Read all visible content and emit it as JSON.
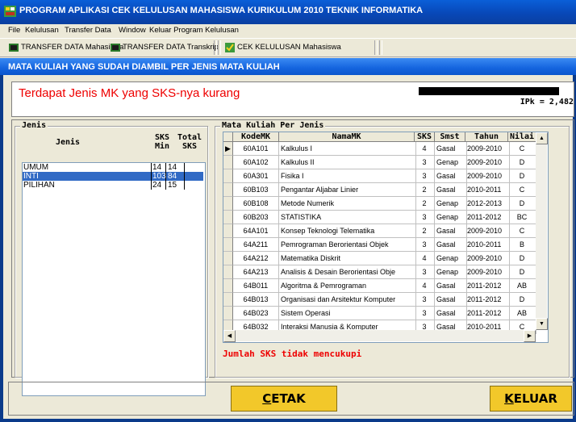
{
  "app": {
    "title": "PROGRAM APLIKASI CEK KELULUSAN MAHASISWA KURIKULUM 2010 TEKNIK INFORMATIKA"
  },
  "menu": [
    "File",
    "Kelulusan",
    "Transfer Data",
    "Window",
    "Keluar Program Kelulusan"
  ],
  "toolbar": {
    "items": [
      {
        "label": "TRANSFER DATA Mahasiswa",
        "icon": "transfer-icon"
      },
      {
        "label": "TRANSFER DATA Transkrip",
        "icon": "transfer-icon"
      },
      {
        "label": "CEK KELULUSAN Mahasiswa",
        "icon": "check-icon"
      }
    ]
  },
  "window": {
    "title": "MATA KULIAH YANG SUDAH DIAMBIL PER JENIS MATA KULIAH"
  },
  "warning": {
    "message": "Terdapat Jenis MK yang SKS-nya kurang",
    "ipk_label": "IPk = 2,482"
  },
  "jenis": {
    "group_label": "Jenis",
    "headers": {
      "jenis": "Jenis",
      "min": "SKS Min",
      "total": "Total SKS"
    },
    "rows": [
      {
        "jenis": "UMUM",
        "min": "14",
        "total": "14",
        "selected": false
      },
      {
        "jenis": "INTI",
        "min": "103",
        "total": "84",
        "selected": true
      },
      {
        "jenis": "PILIHAN",
        "min": "24",
        "total": "15",
        "selected": false
      }
    ]
  },
  "matakuliah": {
    "group_label": "Mata Kuliah Per Jenis",
    "headers": {
      "kode": "KodeMK",
      "nama": "NamaMK",
      "sks": "SKS",
      "smst": "Smst",
      "tahun": "Tahun",
      "nilai": "Nilai"
    },
    "rows": [
      {
        "kode": "60A101",
        "nama": "Kalkulus I",
        "sks": "4",
        "smst": "Gasal",
        "tahun": "2009-2010",
        "nilai": "C",
        "current": true
      },
      {
        "kode": "60A102",
        "nama": "Kalkulus II",
        "sks": "3",
        "smst": "Genap",
        "tahun": "2009-2010",
        "nilai": "D"
      },
      {
        "kode": "60A301",
        "nama": "Fisika I",
        "sks": "3",
        "smst": "Gasal",
        "tahun": "2009-2010",
        "nilai": "D"
      },
      {
        "kode": "60B103",
        "nama": "Pengantar Aljabar Linier",
        "sks": "2",
        "smst": "Gasal",
        "tahun": "2010-2011",
        "nilai": "C"
      },
      {
        "kode": "60B108",
        "nama": "Metode Numerik",
        "sks": "2",
        "smst": "Genap",
        "tahun": "2012-2013",
        "nilai": "D"
      },
      {
        "kode": "60B203",
        "nama": "STATISTIKA",
        "sks": "3",
        "smst": "Genap",
        "tahun": "2011-2012",
        "nilai": "BC"
      },
      {
        "kode": "64A101",
        "nama": "Konsep Teknologi Telematika",
        "sks": "2",
        "smst": "Gasal",
        "tahun": "2009-2010",
        "nilai": "C"
      },
      {
        "kode": "64A211",
        "nama": "Pemrograman Berorientasi Objek",
        "sks": "3",
        "smst": "Gasal",
        "tahun": "2010-2011",
        "nilai": "B"
      },
      {
        "kode": "64A212",
        "nama": "Matematika Diskrit",
        "sks": "4",
        "smst": "Genap",
        "tahun": "2009-2010",
        "nilai": "D"
      },
      {
        "kode": "64A213",
        "nama": "Analisis & Desain Berorientasi Obje",
        "sks": "3",
        "smst": "Genap",
        "tahun": "2009-2010",
        "nilai": "D"
      },
      {
        "kode": "64B011",
        "nama": "Algoritma & Pemrograman",
        "sks": "4",
        "smst": "Gasal",
        "tahun": "2011-2012",
        "nilai": "AB"
      },
      {
        "kode": "64B013",
        "nama": "Organisasi dan Arsitektur Komputer",
        "sks": "3",
        "smst": "Gasal",
        "tahun": "2011-2012",
        "nilai": "D"
      },
      {
        "kode": "64B023",
        "nama": "Sistem Operasi",
        "sks": "3",
        "smst": "Gasal",
        "tahun": "2011-2012",
        "nilai": "AB"
      },
      {
        "kode": "64B032",
        "nama": "Interaksi Manusia & Komputer",
        "sks": "3",
        "smst": "Gasal",
        "tahun": "2010-2011",
        "nilai": "C"
      }
    ]
  },
  "status_message": "Jumlah SKS tidak mencukupi",
  "buttons": {
    "cetak_key": "C",
    "cetak_rest": "ETAK",
    "keluar_key": "K",
    "keluar_rest": "ELUAR"
  },
  "colors": {
    "title_blue": "#0848b8",
    "warning_red": "#e00000",
    "button_yellow": "#f2c82a",
    "selection_blue": "#316ac5"
  }
}
